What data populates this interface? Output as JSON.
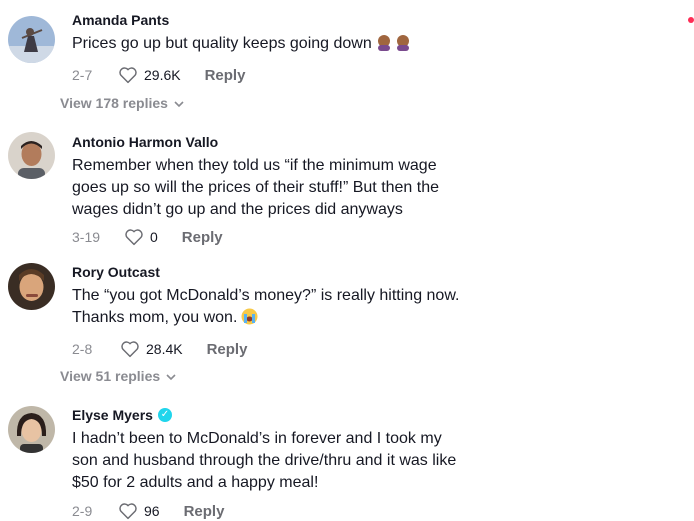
{
  "comments": [
    {
      "author": "Amanda Pants",
      "text": "Prices go up but quality keeps going down",
      "date": "2-7",
      "likes": "29.6K",
      "reply_label": "Reply",
      "view_replies": "View 178 replies",
      "emoji": "person-facepalming-emoji x2"
    },
    {
      "author": "Antonio Harmon Vallo",
      "text": "Remember when they told us “if the minimum wage\ngoes up so will the prices of their stuff!” But then the\nwages didn’t go up and the prices did anyways",
      "date": "3-19",
      "likes": "0",
      "reply_label": "Reply"
    },
    {
      "author": "Rory Outcast",
      "text": "The “you got McDonald’s money?” is really hitting now.\nThanks mom, you won.",
      "date": "2-8",
      "likes": "28.4K",
      "reply_label": "Reply",
      "view_replies": "View 51 replies",
      "emoji": "loudly-crying-face-emoji"
    },
    {
      "author": "Elyse Myers",
      "verified": true,
      "text": "I hadn’t been to McDonald’s in forever and I took my\nson and husband through the drive/thru and it was like\n$50 for 2 adults and a happy meal!",
      "date": "2-9",
      "likes": "96",
      "reply_label": "Reply"
    }
  ],
  "colors": {
    "accent": "#fe2c55",
    "verified": "#20d5ec",
    "muted": "#8a8b91"
  }
}
